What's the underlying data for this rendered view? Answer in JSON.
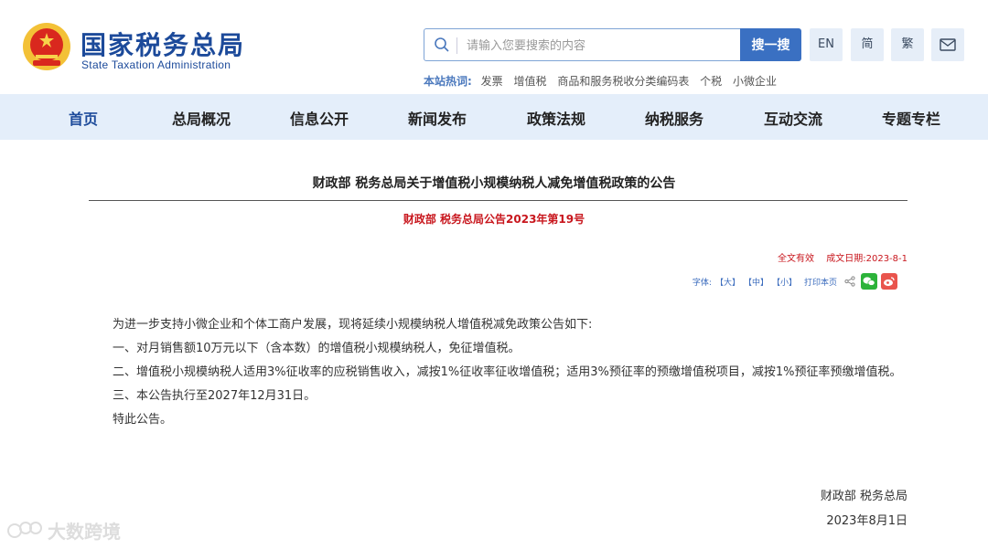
{
  "header": {
    "site_title": "国家税务总局",
    "site_subtitle": "State Taxation Administration",
    "search_placeholder": "请输入您要搜索的内容",
    "search_button": "搜一搜",
    "lang_en": "EN",
    "lang_simplified": "简",
    "lang_traditional": "繁",
    "hot_label": "本站热词:",
    "hot_terms": [
      "发票",
      "增值税",
      "商品和服务税收分类编码表",
      "个税",
      "小微企业"
    ]
  },
  "nav": {
    "items": [
      "首页",
      "总局概况",
      "信息公开",
      "新闻发布",
      "政策法规",
      "纳税服务",
      "互动交流",
      "专题专栏"
    ]
  },
  "article": {
    "title": "财政部 税务总局关于增值税小规模纳税人减免增值税政策的公告",
    "doc_number": "财政部 税务总局公告2023年第19号",
    "status": "全文有效",
    "date_label": "成文日期:2023-8-1",
    "font_label": "字体:",
    "font_large": "【大】",
    "font_medium": "【中】",
    "font_small": "【小】",
    "print_label": "打印本页",
    "paragraphs": [
      "为进一步支持小微企业和个体工商户发展，现将延续小规模纳税人增值税减免政策公告如下:",
      "一、对月销售额10万元以下（含本数）的增值税小规模纳税人，免征增值税。",
      "二、增值税小规模纳税人适用3%征收率的应税销售收入，减按1%征收率征收增值税；适用3%预征率的预缴增值税项目，减按1%预征率预缴增值税。",
      "三、本公告执行至2027年12月31日。",
      "特此公告。"
    ],
    "signature": "财政部 税务总局",
    "signature_date": "2023年8月1日"
  },
  "watermark": "大数跨境",
  "colors": {
    "brand_blue": "#1c4a9a",
    "nav_bg": "#e4eefa",
    "search_btn": "#3a70c2",
    "red": "#c8161d"
  }
}
